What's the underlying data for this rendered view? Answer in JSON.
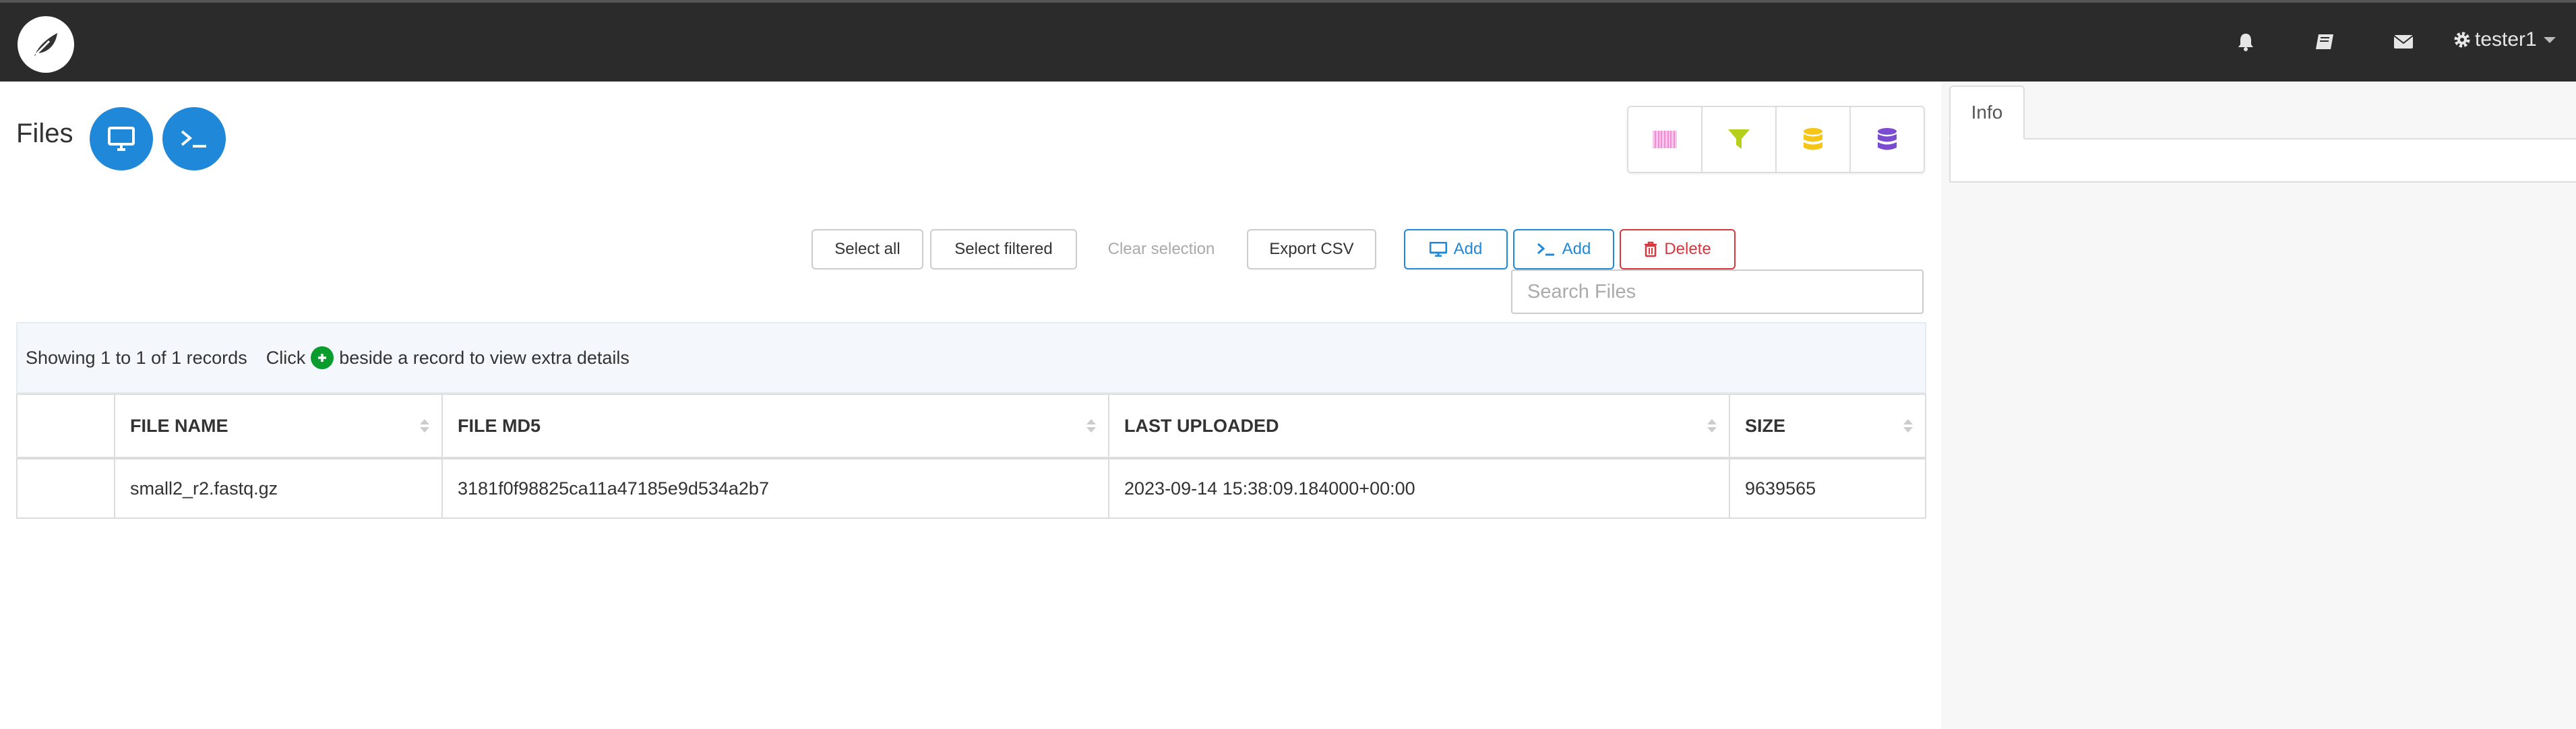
{
  "navbar": {
    "logo": "leaf-logo",
    "icons": [
      "bell-icon",
      "book-icon",
      "envelope-icon"
    ],
    "user": {
      "icon": "gear-icon",
      "name": "tester1"
    }
  },
  "page": {
    "title": "Files",
    "header_buttons": [
      "desktop-icon",
      "terminal-icon"
    ]
  },
  "filter_icons": [
    {
      "name": "barcode-icon",
      "color": "#f08bd4"
    },
    {
      "name": "filter-icon",
      "color": "#b5cf1a"
    },
    {
      "name": "database-icon",
      "color": "#f5c518"
    },
    {
      "name": "database-icon",
      "color": "#7b4bd0"
    }
  ],
  "toolbar": {
    "select_all": "Select all",
    "select_filtered": "Select filtered",
    "clear_selection": "Clear selection",
    "export_csv": "Export CSV",
    "add_desktop": "Add",
    "add_terminal": "Add",
    "delete": "Delete"
  },
  "search": {
    "placeholder": "Search Files",
    "value": ""
  },
  "banner": {
    "showing": "Showing 1 to 1 of 1 records",
    "click": "Click",
    "rest": "beside a record to view extra details"
  },
  "table": {
    "columns": [
      "",
      "FILE NAME",
      "FILE MD5",
      "LAST UPLOADED",
      "SIZE"
    ],
    "rows": [
      [
        "",
        "small2_r2.fastq.gz",
        "3181f0f98825ca11a47185e9d534a2b7",
        "2023-09-14 15:38:09.184000+00:00",
        "9639565"
      ]
    ]
  },
  "right_panel": {
    "tab": "Info"
  },
  "colors": {
    "navbar": "#2b2b2b",
    "primary": "#1f88d8",
    "danger": "#d9363e",
    "success": "#0a9d2e"
  }
}
